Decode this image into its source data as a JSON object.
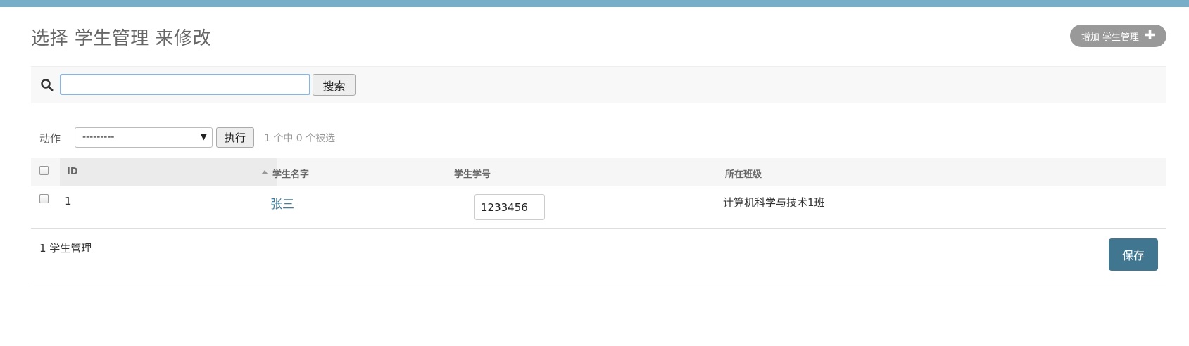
{
  "page": {
    "title": "选择 学生管理 来修改",
    "add_button": "增加 学生管理",
    "add_icon": "plus-icon"
  },
  "search": {
    "icon": "search-icon",
    "value": "",
    "button": "搜索"
  },
  "actions": {
    "label": "动作",
    "selected_option": "---------",
    "run_button": "执行",
    "selected_count": "1 个中 0 个被选"
  },
  "table": {
    "columns": [
      "ID",
      "学生名字",
      "学生学号",
      "所在班级"
    ],
    "sorted_column": "ID",
    "sort_direction": "ascending",
    "rows": [
      {
        "id": "1",
        "name": "张三",
        "student_no": "1233456",
        "class": "计算机科学与技术1班"
      }
    ]
  },
  "footer": {
    "count": "1 学生管理",
    "save_button": "保存"
  },
  "colors": {
    "topbar": "#79aec8",
    "link": "#447e9b",
    "save_button": "#417690",
    "add_button": "#999999"
  }
}
